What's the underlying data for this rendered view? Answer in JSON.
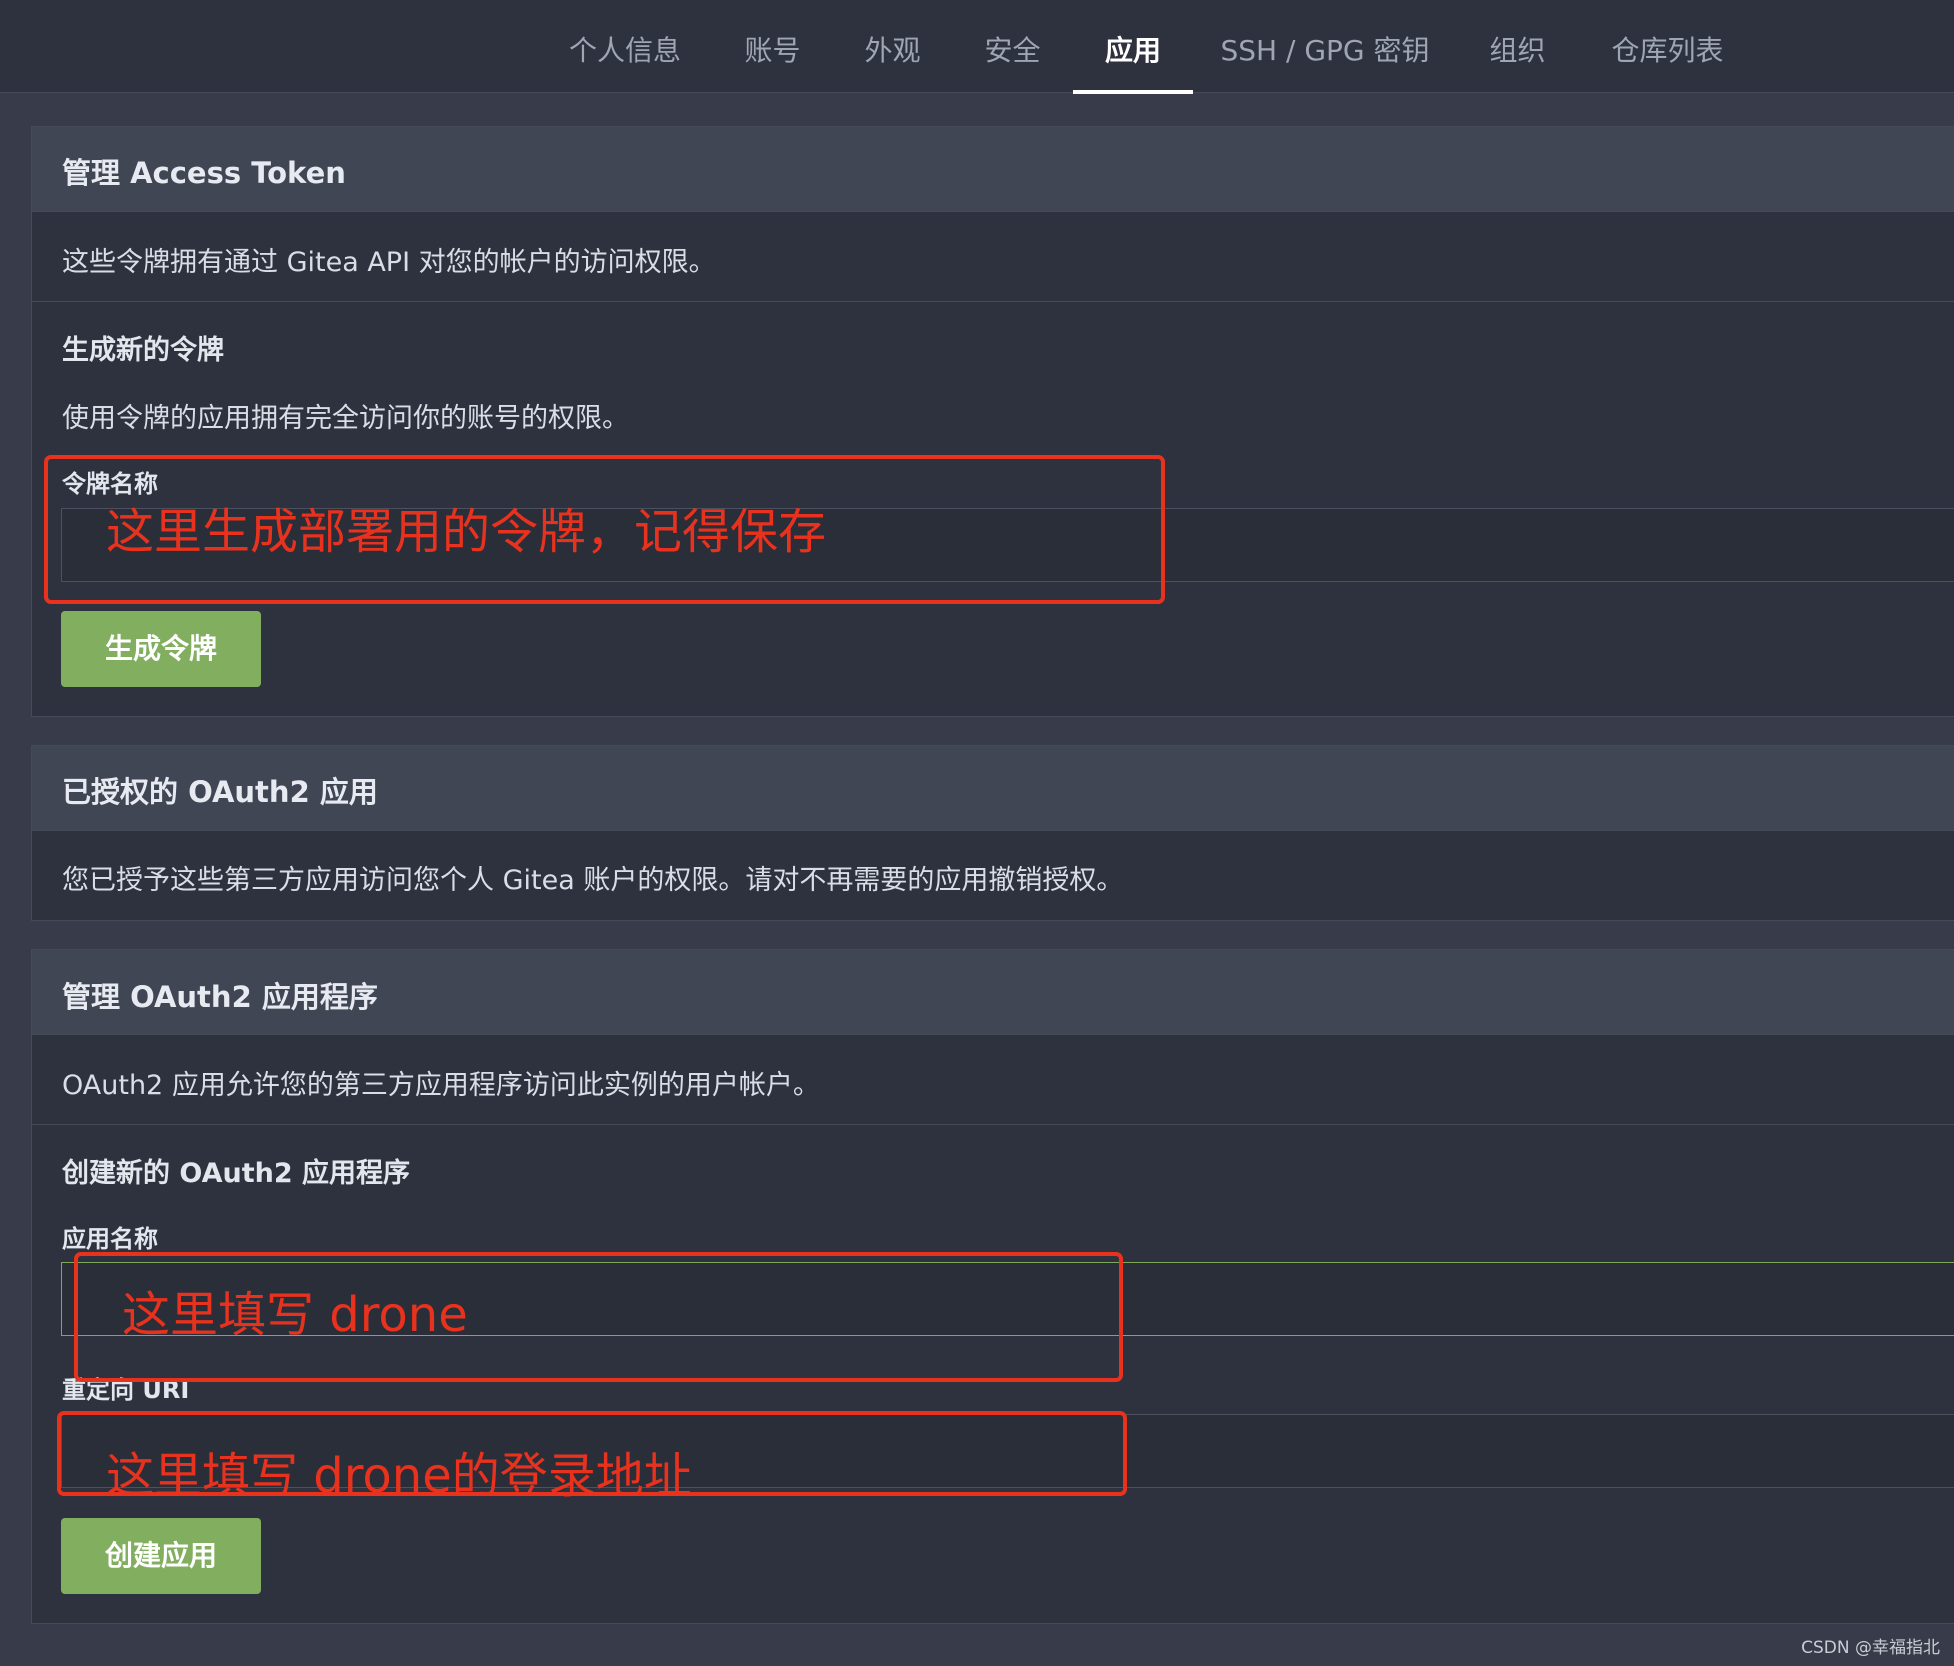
{
  "nav": {
    "tabs": [
      {
        "label": "个人信息"
      },
      {
        "label": "账号"
      },
      {
        "label": "外观"
      },
      {
        "label": "安全"
      },
      {
        "label": "应用"
      },
      {
        "label": "SSH / GPG 密钥"
      },
      {
        "label": "组织"
      },
      {
        "label": "仓库列表"
      }
    ],
    "active": "应用"
  },
  "access_token": {
    "title": "管理 Access Token",
    "description": "这些令牌拥有通过 Gitea API 对您的帐户的访问权限。",
    "generate_title": "生成新的令牌",
    "generate_description": "使用令牌的应用拥有完全访问你的账号的权限。",
    "name_label": "令牌名称",
    "name_value": "",
    "button": "生成令牌"
  },
  "authorized_oauth": {
    "title": "已授权的 OAuth2 应用",
    "description": "您已授予这些第三方应用访问您个人 Gitea 账户的权限。请对不再需要的应用撤销授权。"
  },
  "manage_oauth": {
    "title": "管理 OAuth2 应用程序",
    "description": "OAuth2 应用允许您的第三方应用程序访问此实例的用户帐户。",
    "create_title": "创建新的 OAuth2 应用程序",
    "app_name_label": "应用名称",
    "app_name_value": "",
    "redirect_label": "重定向 URI",
    "redirect_value": "",
    "button": "创建应用"
  },
  "annotations": {
    "token_note": "这里生成部署用的令牌，记得保存",
    "app_name_note": "这里填写 drone",
    "redirect_note": "这里填写 drone的登录地址"
  },
  "watermark": "CSDN @幸福指北",
  "colors": {
    "background": "#383c4a",
    "panel": "#2e323e",
    "panel_header": "#404654",
    "button": "#82ae5f",
    "annotation_red": "#e8321e"
  }
}
